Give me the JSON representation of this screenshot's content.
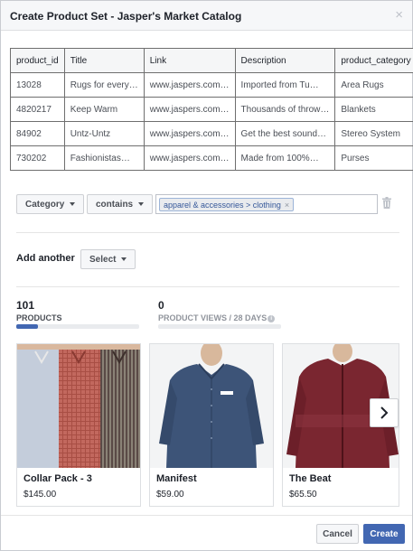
{
  "dialog": {
    "title": "Create Product Set - Jasper's Market Catalog",
    "close_glyph": "×"
  },
  "table": {
    "headers": [
      "product_id",
      "Title",
      "Link",
      "Description",
      "product_category"
    ],
    "rows": [
      [
        "13028",
        "Rugs for every…",
        "www.jaspers.com…",
        "Imported from Tu…",
        "Area Rugs"
      ],
      [
        "4820217",
        "Keep Warm",
        "www.jaspers.com…",
        "Thousands of throw…",
        "Blankets"
      ],
      [
        "84902",
        "Untz-Untz",
        "www.jaspers.com…",
        "Get the best sound…",
        "Stereo System"
      ],
      [
        "730202",
        "Fashionistas…",
        "www.jaspers.com…",
        "Made from 100%…",
        "Purses"
      ]
    ]
  },
  "filter": {
    "field_label": "Category",
    "operator_label": "contains",
    "token": "apparel & accessories > clothing",
    "token_remove": "×"
  },
  "add_another": {
    "label": "Add another",
    "select_label": "Select"
  },
  "stats": {
    "products": {
      "value": "101",
      "label": "PRODUCTS",
      "progress": 0.18
    },
    "views": {
      "value": "0",
      "label": "PRODUCT VIEWS / 28 DAYS",
      "info_glyph": "i",
      "progress": 0
    }
  },
  "products": [
    {
      "name": "Collar Pack - 3",
      "price": "$145.00"
    },
    {
      "name": "Manifest",
      "price": "$59.00"
    },
    {
      "name": "The Beat",
      "price": "$65.50"
    }
  ],
  "footer": {
    "cancel_label": "Cancel",
    "create_label": "Create"
  },
  "colors": {
    "accent": "#4267b2",
    "text": "#1d2129",
    "border": "#dddfe2"
  },
  "icons": {
    "close": "close-icon",
    "trash": "trash-icon",
    "dropdown": "chevron-down-icon",
    "next": "chevron-right-icon",
    "info": "info-icon"
  }
}
